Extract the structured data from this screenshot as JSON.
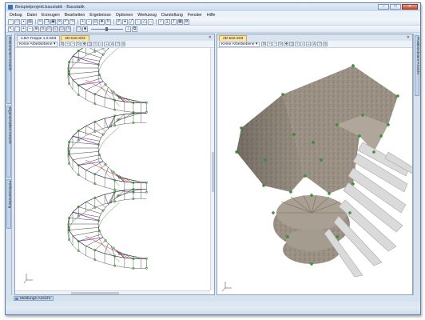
{
  "window": {
    "title": "Beispielprojekt.baustatik - Baustatik"
  },
  "window_buttons": {
    "minimize": "–",
    "maximize": "□",
    "close": "✕"
  },
  "menu": [
    "Debug",
    "Datei",
    "Erzeugen",
    "Bearbeiten",
    "Ergebnisse",
    "Optionen",
    "Werkzeug",
    "Darstellung",
    "Fenster",
    "Hilfe"
  ],
  "left_dock": {
    "tab1": "Dokumenten-Ansicht",
    "tab2": "Eigenschaften-Ansicht",
    "tab3": "Fehlersammlung"
  },
  "right_dock": {
    "tab1": "Positionsbaum-Ansicht"
  },
  "left_pane": {
    "tabs": [
      "1.BA Treppe 1.0.S03",
      "2D-test.S03"
    ],
    "active_tab": 1,
    "layer_select": "Keine Arbeitsebene ▾"
  },
  "right_pane": {
    "tabs": [
      "2D-test.S03"
    ],
    "active_tab": 0,
    "layer_select": "Keine Arbeitsebene ▾"
  },
  "bottom": {
    "messages_tab": "Meldungs-Ansicht"
  },
  "colors": {
    "node": "#2f9e2f",
    "wire": "#111111",
    "purple": "#8a3dbe",
    "red": "#d32020",
    "stone": "#9c9286",
    "steps": "#d7d7d7"
  }
}
